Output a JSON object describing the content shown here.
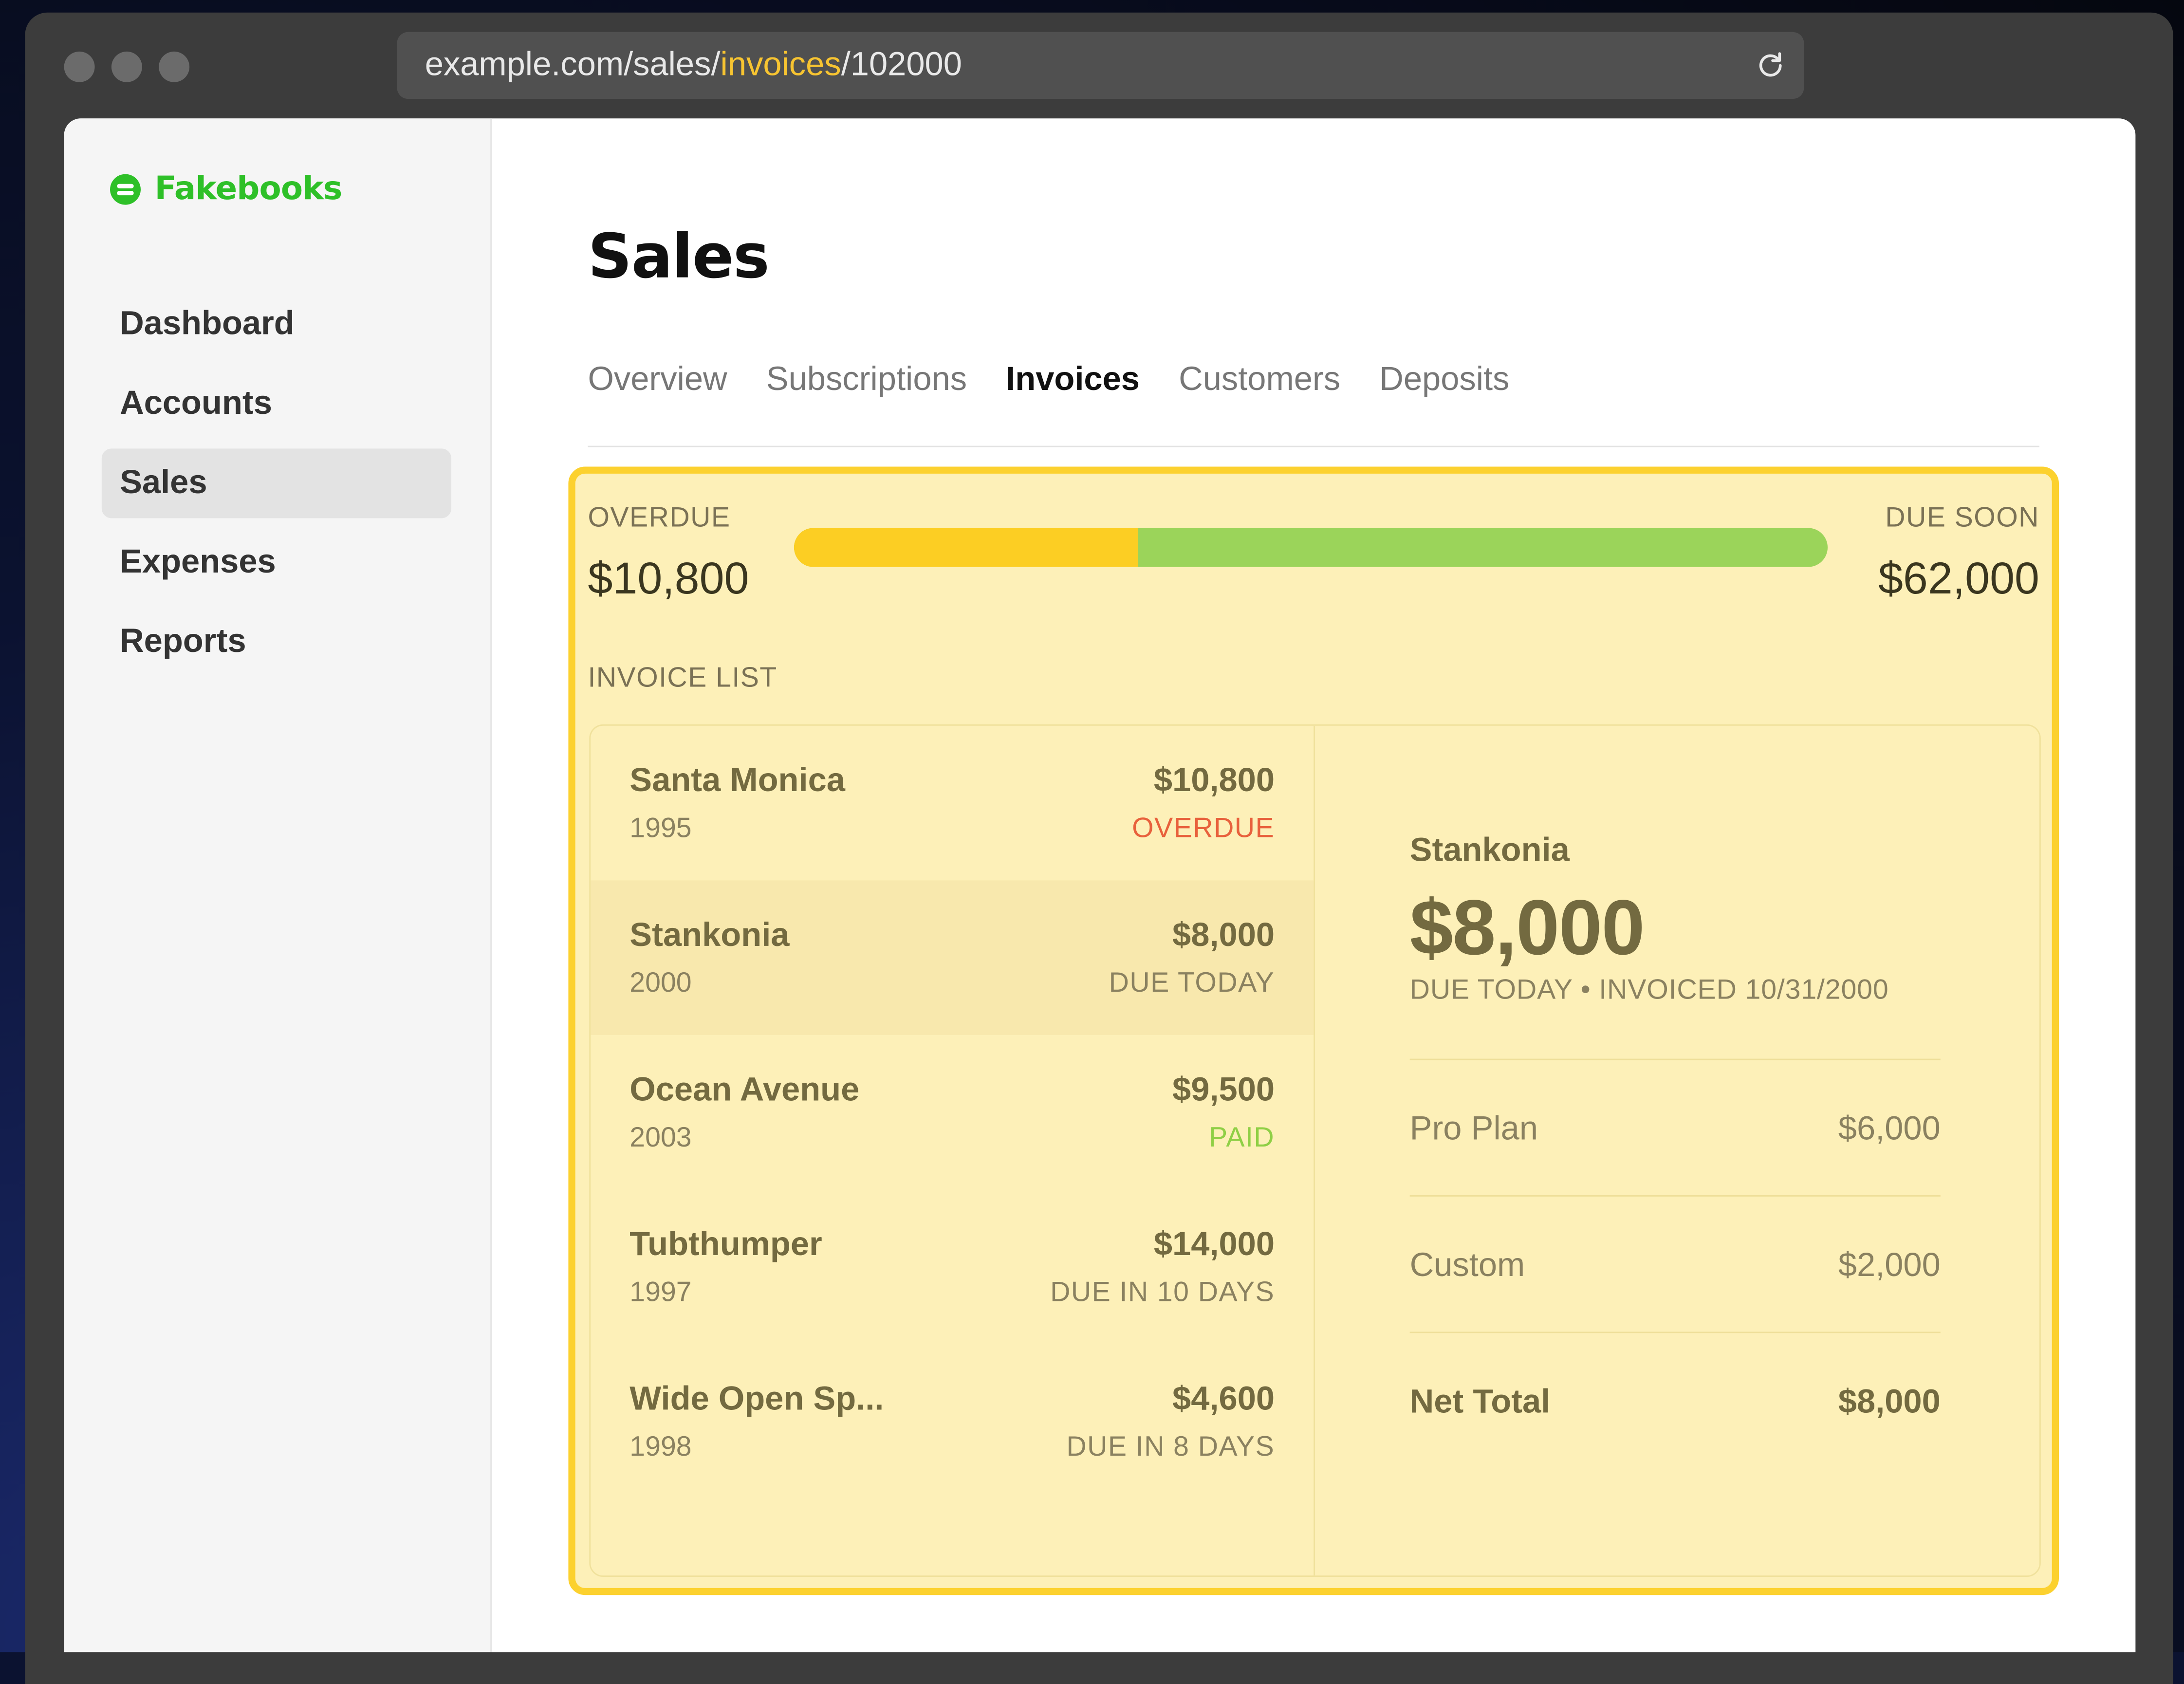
{
  "browser": {
    "url_prefix": "example.com/sales/",
    "url_highlight": "invoices",
    "url_suffix": "/102000"
  },
  "brand": {
    "name": "Fakebooks",
    "color": "#2ec028"
  },
  "sidebar": {
    "items": [
      {
        "label": "Dashboard",
        "active": false
      },
      {
        "label": "Accounts",
        "active": false
      },
      {
        "label": "Sales",
        "active": true
      },
      {
        "label": "Expenses",
        "active": false
      },
      {
        "label": "Reports",
        "active": false
      }
    ]
  },
  "page": {
    "title": "Sales"
  },
  "tabs": [
    {
      "label": "Overview",
      "active": false
    },
    {
      "label": "Subscriptions",
      "active": false
    },
    {
      "label": "Invoices",
      "active": true
    },
    {
      "label": "Customers",
      "active": false
    },
    {
      "label": "Deposits",
      "active": false
    }
  ],
  "summary": {
    "overdue_label": "OVERDUE",
    "overdue_amount": "$10,800",
    "due_soon_label": "DUE SOON",
    "due_soon_amount": "$62,000",
    "overdue_fraction": 0.333,
    "colors": {
      "overdue": "#fcce23",
      "due_soon": "#9bd45a"
    }
  },
  "invoice_list": {
    "label": "INVOICE LIST",
    "rows": [
      {
        "name": "Santa Monica",
        "year": "1995",
        "amount": "$10,800",
        "status": "OVERDUE",
        "status_color": "#e8613c",
        "selected": false
      },
      {
        "name": "Stankonia",
        "year": "2000",
        "amount": "$8,000",
        "status": "DUE TODAY",
        "status_color": "#8a8160",
        "selected": true
      },
      {
        "name": "Ocean Avenue",
        "year": "2003",
        "amount": "$9,500",
        "status": "PAID",
        "status_color": "#8fcf45",
        "selected": false
      },
      {
        "name": "Tubthumper",
        "year": "1997",
        "amount": "$14,000",
        "status": "DUE IN 10 DAYS",
        "status_color": "#8a8160",
        "selected": false
      },
      {
        "name": "Wide Open Sp...",
        "year": "1998",
        "amount": "$4,600",
        "status": "DUE IN 8 DAYS",
        "status_color": "#8a8160",
        "selected": false
      }
    ]
  },
  "detail": {
    "name": "Stankonia",
    "amount": "$8,000",
    "meta": "DUE TODAY • INVOICED 10/31/2000",
    "lines": [
      {
        "label": "Pro Plan",
        "value": "$6,000"
      },
      {
        "label": "Custom",
        "value": "$2,000"
      }
    ],
    "total": {
      "label": "Net Total",
      "value": "$8,000"
    }
  },
  "highlight_color": "#fcd12f"
}
